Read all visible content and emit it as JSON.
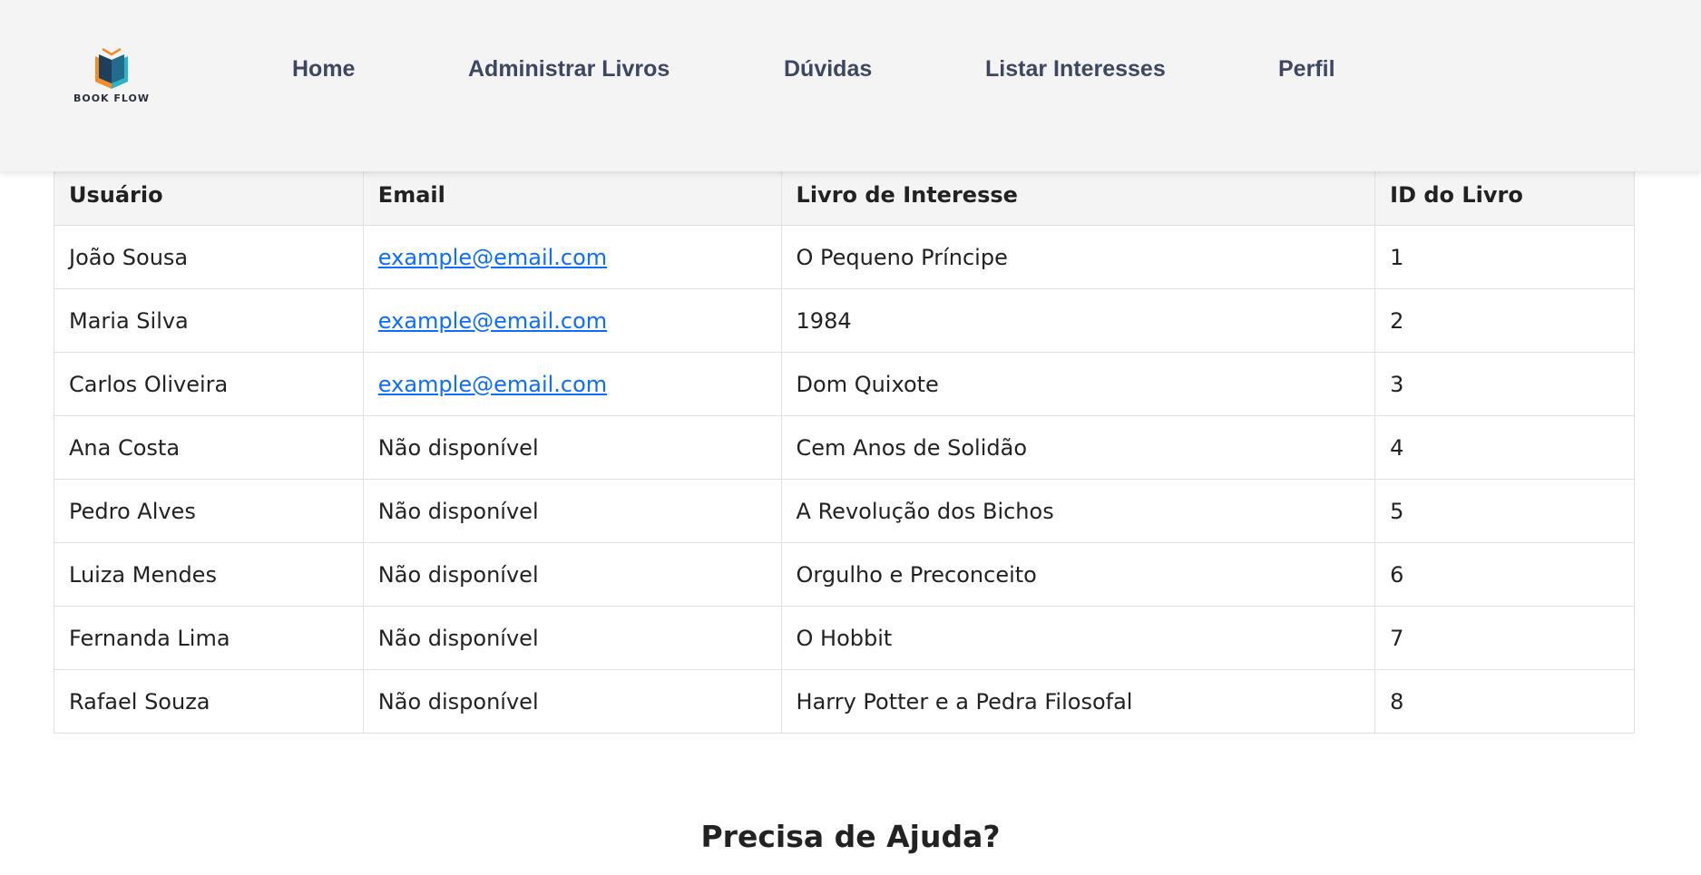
{
  "brand": {
    "name": "BOOK FLOW",
    "logo_icon": "open-book-icon",
    "colors": {
      "orange": "#f28c28",
      "teal": "#2bb3c6",
      "dark": "#1d3f5c"
    }
  },
  "nav": {
    "items": [
      {
        "label": "Home"
      },
      {
        "label": "Administrar Livros"
      },
      {
        "label": "Dúvidas"
      },
      {
        "label": "Listar Interesses"
      },
      {
        "label": "Perfil"
      }
    ]
  },
  "table": {
    "headers": [
      "Usuário",
      "Email",
      "Livro de Interesse",
      "ID do Livro"
    ],
    "rows": [
      {
        "user": "João Sousa",
        "email": "example@email.com",
        "email_is_link": true,
        "book": "O Pequeno Príncipe",
        "id": "1"
      },
      {
        "user": "Maria Silva",
        "email": "example@email.com",
        "email_is_link": true,
        "book": "1984",
        "id": "2"
      },
      {
        "user": "Carlos Oliveira",
        "email": "example@email.com",
        "email_is_link": true,
        "book": "Dom Quixote",
        "id": "3"
      },
      {
        "user": "Ana Costa",
        "email": "Não disponível",
        "email_is_link": false,
        "book": "Cem Anos de Solidão",
        "id": "4"
      },
      {
        "user": "Pedro Alves",
        "email": "Não disponível",
        "email_is_link": false,
        "book": "A Revolução dos Bichos",
        "id": "5"
      },
      {
        "user": "Luiza Mendes",
        "email": "Não disponível",
        "email_is_link": false,
        "book": "Orgulho e Preconceito",
        "id": "6"
      },
      {
        "user": "Fernanda Lima",
        "email": "Não disponível",
        "email_is_link": false,
        "book": "O Hobbit",
        "id": "7"
      },
      {
        "user": "Rafael Souza",
        "email": "Não disponível",
        "email_is_link": false,
        "book": "Harry Potter e a Pedra Filosofal",
        "id": "8"
      }
    ]
  },
  "help": {
    "prefix": "Precisa de ",
    "emphasis": "Ajuda?"
  }
}
